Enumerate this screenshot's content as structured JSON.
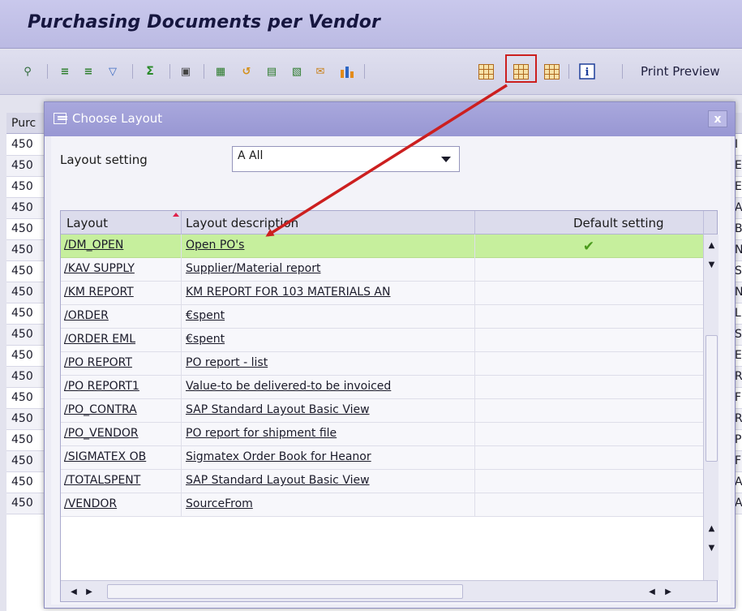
{
  "app": {
    "title": "Purchasing Documents per Vendor"
  },
  "toolbar": {
    "icons": [
      "details-icon",
      "sort-ascending-icon",
      "sort-descending-icon",
      "filter-icon",
      "sum-icon",
      "subtotal-icon",
      "export-icon",
      "spreadsheet-icon",
      "word-processing-icon",
      "local-file-icon",
      "mail-icon",
      "abc-analysis-icon",
      "graphic-icon",
      "choose-layout-icon",
      "change-layout-icon",
      "save-layout-icon",
      "information-icon"
    ],
    "print_preview": "Print Preview"
  },
  "background_list": {
    "header": "Purc",
    "rows": [
      {
        "left": "450",
        "right": "I"
      },
      {
        "left": "450",
        "right": "E"
      },
      {
        "left": "450",
        "right": "E"
      },
      {
        "left": "450",
        "right": "A"
      },
      {
        "left": "450",
        "right": "B"
      },
      {
        "left": "450",
        "right": "N"
      },
      {
        "left": "450",
        "right": "S"
      },
      {
        "left": "450",
        "right": "N"
      },
      {
        "left": "450",
        "right": "L"
      },
      {
        "left": "450",
        "right": "S"
      },
      {
        "left": "450",
        "right": "E"
      },
      {
        "left": "450",
        "right": "R"
      },
      {
        "left": "450",
        "right": "F"
      },
      {
        "left": "450",
        "right": "R"
      },
      {
        "left": "450",
        "right": "P"
      },
      {
        "left": "450",
        "right": "F"
      },
      {
        "left": "450",
        "right": "A"
      },
      {
        "left": "450",
        "right": "A"
      }
    ]
  },
  "dialog": {
    "title": "Choose Layout",
    "close_label": "x",
    "layout_setting_label": "Layout setting",
    "layout_setting_value": "A All",
    "columns": {
      "layout": "Layout",
      "description": "Layout description",
      "default": "Default setting"
    },
    "rows": [
      {
        "layout": "/DM_OPEN",
        "description": "Open PO's",
        "default": true,
        "selected": true
      },
      {
        "layout": "/KAV SUPPLY",
        "description": "Supplier/Material report",
        "default": false
      },
      {
        "layout": "/KM REPORT",
        "description": "KM REPORT FOR 103 MATERIALS AN",
        "default": false
      },
      {
        "layout": "/ORDER",
        "description": "€spent",
        "default": false
      },
      {
        "layout": "/ORDER EML",
        "description": "€spent",
        "default": false
      },
      {
        "layout": "/PO REPORT",
        "description": "PO report - list",
        "default": false
      },
      {
        "layout": "/PO REPORT1",
        "description": "Value-to be delivered-to be invoiced",
        "default": false
      },
      {
        "layout": "/PO_CONTRA",
        "description": "SAP Standard Layout Basic View",
        "default": false
      },
      {
        "layout": "/PO_VENDOR",
        "description": "PO report for shipment file",
        "default": false
      },
      {
        "layout": "/SIGMATEX OB",
        "description": "Sigmatex Order Book for Heanor",
        "default": false
      },
      {
        "layout": "/TOTALSPENT",
        "description": "SAP Standard Layout Basic View",
        "default": false
      },
      {
        "layout": "/VENDOR",
        "description": "SourceFrom",
        "default": false
      }
    ]
  }
}
